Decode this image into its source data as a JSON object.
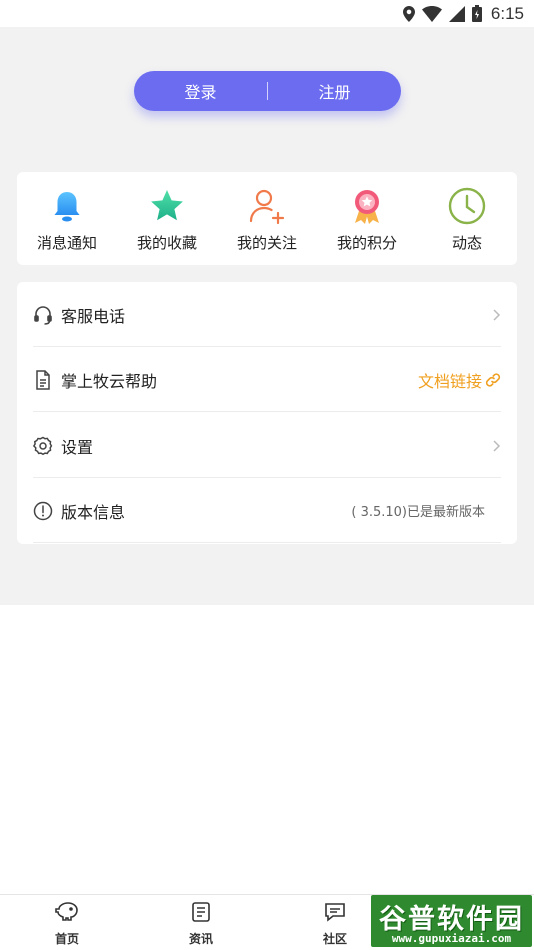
{
  "status_bar": {
    "time": "6:15"
  },
  "auth": {
    "login_label": "登录",
    "register_label": "注册"
  },
  "quick_actions": [
    {
      "label": "消息通知",
      "icon": "bell-icon",
      "color": "#3aa8f5"
    },
    {
      "label": "我的收藏",
      "icon": "star-icon",
      "color": "#2fc59a"
    },
    {
      "label": "我的关注",
      "icon": "user-add-icon",
      "color": "#f07a4a"
    },
    {
      "label": "我的积分",
      "icon": "medal-icon",
      "color": "#f25a7a"
    },
    {
      "label": "动态",
      "icon": "clock-icon",
      "color": "#8ab34a"
    }
  ],
  "menu": {
    "service_phone": {
      "label": "客服电话"
    },
    "help": {
      "label": "掌上牧云帮助",
      "link_text": "文档链接"
    },
    "settings": {
      "label": "设置"
    },
    "version": {
      "label": "版本信息",
      "value": "( 3.5.10)已是最新版本"
    }
  },
  "tabbar": [
    {
      "label": "首页",
      "icon": "home-pig-icon"
    },
    {
      "label": "资讯",
      "icon": "news-icon"
    },
    {
      "label": "社区",
      "icon": "chat-icon"
    }
  ],
  "watermark": {
    "brand": "谷普软件园",
    "url": "www.gupuxiazai.com"
  },
  "colors": {
    "accent": "#6b6cf0",
    "link": "#f0a020",
    "background": "#f2f2f2"
  }
}
